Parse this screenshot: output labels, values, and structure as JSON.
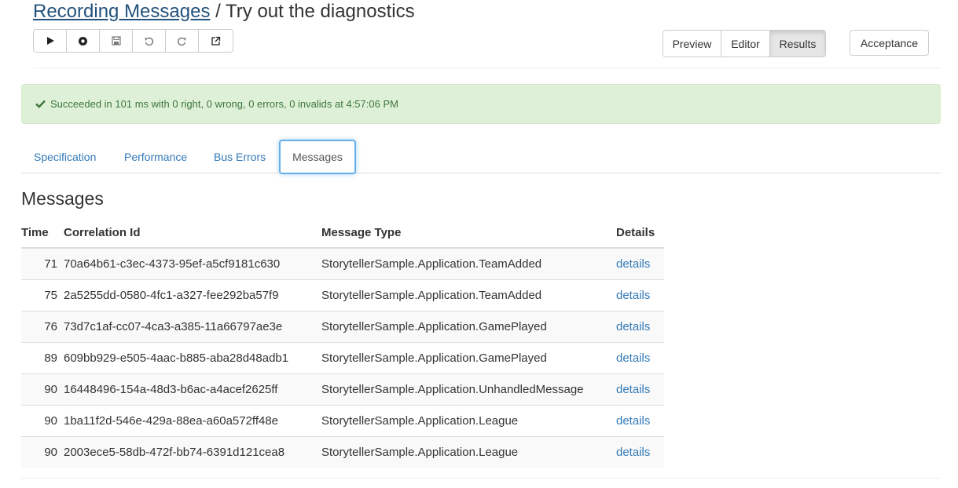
{
  "header": {
    "title_link": "Recording Messages",
    "title_separator": " / ",
    "title_rest": "Try out the diagnostics"
  },
  "toolbar": {
    "buttons": [
      {
        "name": "run-button",
        "icon": "play-icon"
      },
      {
        "name": "record-button",
        "icon": "record-icon"
      },
      {
        "name": "save-button",
        "icon": "save-icon"
      },
      {
        "name": "undo-button",
        "icon": "undo-icon"
      },
      {
        "name": "redo-button",
        "icon": "redo-icon"
      },
      {
        "name": "open-external-button",
        "icon": "external-link-icon"
      }
    ]
  },
  "view_modes": {
    "preview": "Preview",
    "editor": "Editor",
    "results": "Results",
    "active": "Results"
  },
  "lifecycle_button": "Acceptance",
  "status": {
    "icon": "check-icon",
    "text": "Succeeded in 101 ms with 0 right, 0 wrong, 0 errors, 0 invalids at 4:57:06 PM",
    "color": "#3c763d",
    "background": "#dff0d8"
  },
  "tabs": {
    "specification": "Specification",
    "performance": "Performance",
    "bus_errors": "Bus Errors",
    "messages": "Messages",
    "active": "Messages"
  },
  "section_title": "Messages",
  "table": {
    "headers": {
      "time": "Time",
      "correlation_id": "Correlation Id",
      "message_type": "Message Type",
      "details": "Details"
    },
    "rows": [
      {
        "time": "71",
        "correlation_id": "70a64b61-c3ec-4373-95ef-a5cf9181c630",
        "message_type": "StorytellerSample.Application.TeamAdded",
        "details": "details"
      },
      {
        "time": "75",
        "correlation_id": "2a5255dd-0580-4fc1-a327-fee292ba57f9",
        "message_type": "StorytellerSample.Application.TeamAdded",
        "details": "details"
      },
      {
        "time": "76",
        "correlation_id": "73d7c1af-cc07-4ca3-a385-11a66797ae3e",
        "message_type": "StorytellerSample.Application.GamePlayed",
        "details": "details"
      },
      {
        "time": "89",
        "correlation_id": "609bb929-e505-4aac-b885-aba28d48adb1",
        "message_type": "StorytellerSample.Application.GamePlayed",
        "details": "details"
      },
      {
        "time": "90",
        "correlation_id": "16448496-154a-48d3-b6ac-a4acef2625ff",
        "message_type": "StorytellerSample.Application.UnhandledMessage",
        "details": "details"
      },
      {
        "time": "90",
        "correlation_id": "1ba11f2d-546e-429a-88ea-a60a572ff48e",
        "message_type": "StorytellerSample.Application.League",
        "details": "details"
      },
      {
        "time": "90",
        "correlation_id": "2003ece5-58db-472f-bb74-6391d121cea8",
        "message_type": "StorytellerSample.Application.League",
        "details": "details"
      }
    ]
  },
  "colors": {
    "link": "#337ab7",
    "title_link": "#23527c",
    "active_tab_border": "#66afe9"
  }
}
